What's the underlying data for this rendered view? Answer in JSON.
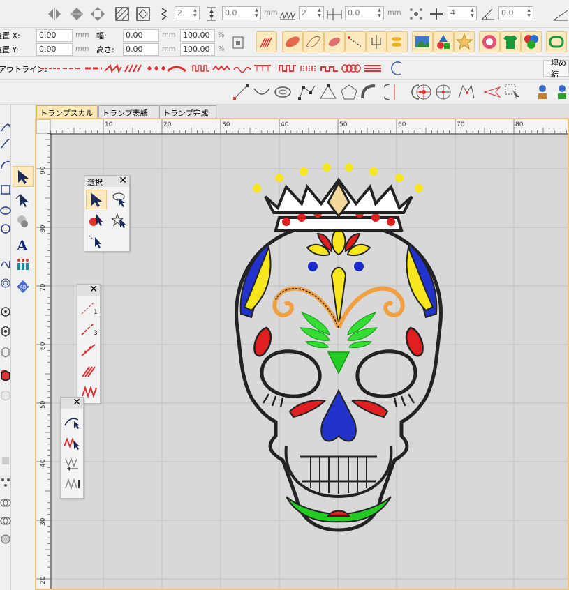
{
  "toolbar1": {
    "spin_a": "2",
    "spin_b": "0.0",
    "spin_c": "2",
    "spin_d": "0.0",
    "spin_e": "4",
    "spin_f": "0.0",
    "unit_mm": "mm"
  },
  "props": {
    "pos_x_label": "位置 X:",
    "pos_y_label": "位置 Y:",
    "pos_x": "0.00",
    "pos_y": "0.00",
    "unit": "mm",
    "width_label": "幅:",
    "height_label": "高さ:",
    "width": "0.00",
    "height": "0.00",
    "scale_w": "100.00",
    "scale_h": "100.00",
    "percent": "%"
  },
  "outline_bar": {
    "label": "アウトライン:",
    "fill_label": "埋め結"
  },
  "tabs": [
    {
      "label": "トランプスカル",
      "close": "✕"
    },
    {
      "label": "トランプ表紙",
      "close": "✕"
    },
    {
      "label": "トランプ完成",
      "close": "✕"
    }
  ],
  "ruler": {
    "h_ticks": [
      "10",
      "20",
      "30",
      "40",
      "50",
      "60",
      "70",
      "80"
    ],
    "v_ticks": [
      "90",
      "80",
      "70",
      "60",
      "50",
      "40",
      "30",
      "20"
    ]
  },
  "select_panel": {
    "title": "選択",
    "close": "✕"
  },
  "panel2": {
    "close": "✕"
  },
  "panel3": {
    "close": "✕"
  },
  "line_tool_labels": [
    "1",
    "3"
  ],
  "colors": {
    "accent_tab": "#fbe9b7",
    "canvas": "#d8d8d8",
    "grid": "#bfbfbf",
    "red": "#e02020",
    "yellow": "#f5e61e",
    "blue": "#2233cc",
    "green": "#22cc22",
    "orange": "#f0a040",
    "black_outline": "#222222"
  }
}
